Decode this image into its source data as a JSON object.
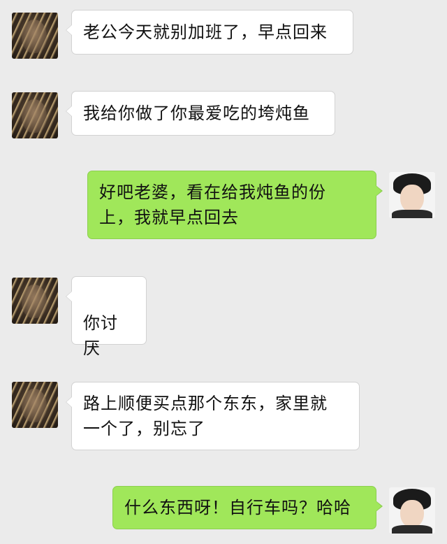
{
  "theme": {
    "background": "#ebebeb",
    "incoming_bubble": "#ffffff",
    "outgoing_bubble": "#a0e75a"
  },
  "messages": [
    {
      "sender": "她",
      "direction": "incoming",
      "avatar_icon": "woman-avatar",
      "text": "老公今天就别加班了，早点回来"
    },
    {
      "sender": "她",
      "direction": "incoming",
      "avatar_icon": "woman-avatar",
      "text": "我给你做了你最爱吃的垮炖鱼"
    },
    {
      "sender": "他",
      "direction": "outgoing",
      "avatar_icon": "man-avatar",
      "text": "好吧老婆，看在给我炖鱼的份\n上，我就早点回去"
    },
    {
      "sender": "她",
      "direction": "incoming",
      "avatar_icon": "woman-avatar",
      "text": "你讨厌"
    },
    {
      "sender": "她",
      "direction": "incoming",
      "avatar_icon": "woman-avatar",
      "text": "路上顺便买点那个东东，家里就\n一个了，别忘了"
    },
    {
      "sender": "他",
      "direction": "outgoing",
      "avatar_icon": "man-avatar",
      "text": "什么东西呀！自行车吗？哈哈"
    }
  ]
}
